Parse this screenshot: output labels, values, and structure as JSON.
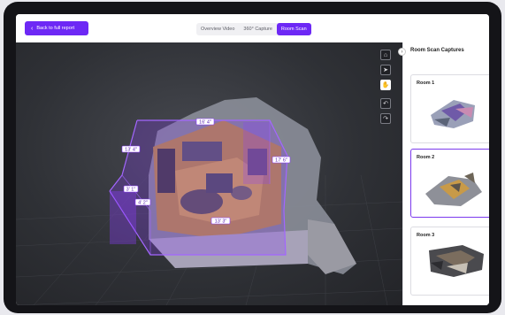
{
  "header": {
    "back_label": "Back to full report",
    "tabs": [
      {
        "label": "Overview Video"
      },
      {
        "label": "360° Capture"
      },
      {
        "label": "Room Scan",
        "active": true
      }
    ]
  },
  "viewer": {
    "dimensions": [
      "16' 4\"",
      "13' 4\"",
      "17' 6\"",
      "3' 1\"",
      "4' 2\"",
      "13' 3\""
    ],
    "tools": [
      "tag-icon",
      "pointer-icon",
      "hand-icon",
      "undo-icon",
      "redo-icon"
    ],
    "active_tool": "hand-icon"
  },
  "panel": {
    "title": "Room Scan Captures",
    "collapse_glyph": "›",
    "rooms": [
      {
        "label": "Room 1"
      },
      {
        "label": "Room 2",
        "selected": true
      },
      {
        "label": "Room 3"
      }
    ]
  },
  "colors": {
    "accent": "#6d28f5",
    "scan_box": "#8b3dff",
    "viewport_bg": "#2f3136"
  }
}
